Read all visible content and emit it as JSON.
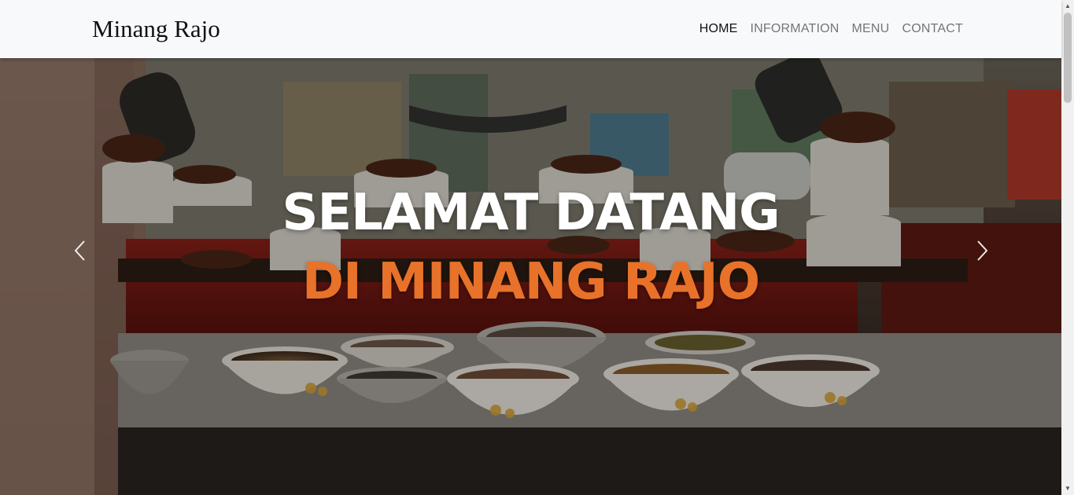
{
  "brand": "Minang Rajo",
  "nav": [
    {
      "label": "HOME",
      "active": true
    },
    {
      "label": "INFORMATION",
      "active": false
    },
    {
      "label": "MENU",
      "active": false
    },
    {
      "label": "CONTACT",
      "active": false
    }
  ],
  "hero": {
    "line1": "SELAMAT DATANG",
    "line2": "DI MINANG RAJO",
    "prev_icon": "chevron-left-icon",
    "next_icon": "chevron-right-icon"
  },
  "colors": {
    "accent": "#e8722a",
    "navbar_bg": "#f8f9fa",
    "nav_text": "#757575",
    "nav_active": "#111111"
  }
}
